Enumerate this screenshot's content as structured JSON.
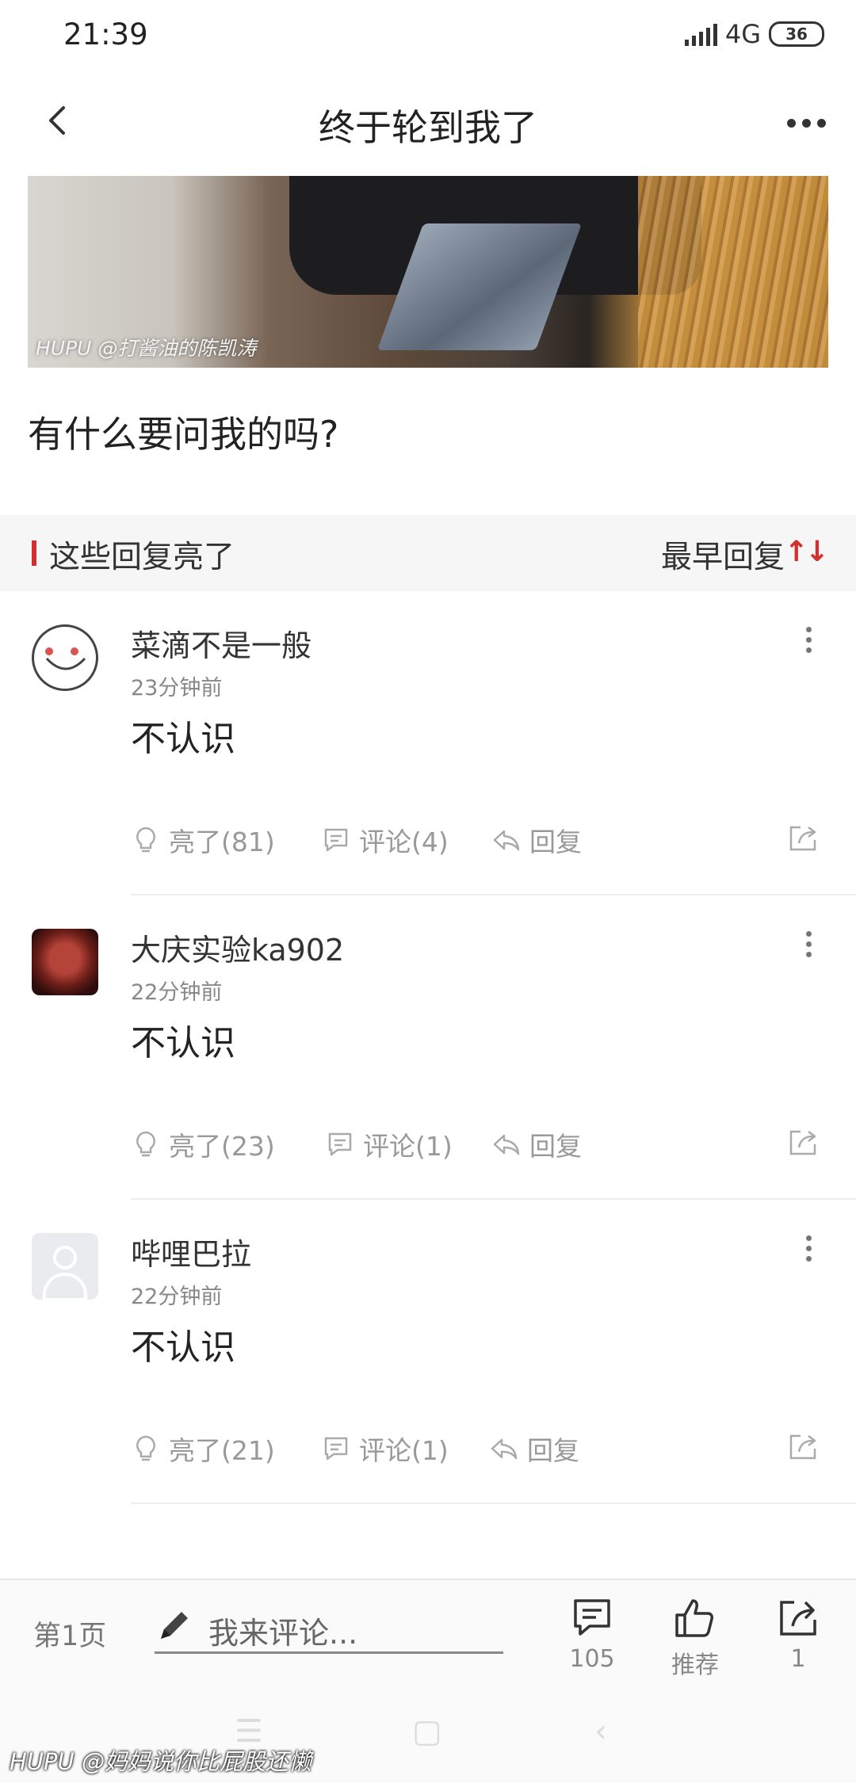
{
  "status_bar": {
    "time": "21:39",
    "network": "4G",
    "battery": "36"
  },
  "nav": {
    "title": "终于轮到我了"
  },
  "hero": {
    "watermark": "HUPU @打酱油的陈凯涛"
  },
  "post": {
    "text": "有什么要问我的吗?"
  },
  "highlights": {
    "title": "这些回复亮了",
    "sort_label": "最早回复",
    "sort_icon": "sort-arrows-icon"
  },
  "comments": [
    {
      "user": "菜滴不是一般",
      "time": "23分钟前",
      "text": "不认识",
      "light": "亮了(81)",
      "comment": "评论(4)",
      "reply": "回复"
    },
    {
      "user": "大庆实验ka902",
      "time": "22分钟前",
      "text": "不认识",
      "light": "亮了(23)",
      "comment": "评论(1)",
      "reply": "回复"
    },
    {
      "user": "哔哩巴拉",
      "time": "22分钟前",
      "text": "不认识",
      "light": "亮了(21)",
      "comment": "评论(1)",
      "reply": "回复"
    }
  ],
  "bottom_bar": {
    "page_label": "第1页",
    "input_placeholder": "我来评论...",
    "comment_count": "105",
    "recommend_label": "推荐",
    "share_count": "1"
  },
  "watermark_bottom": "HUPU @妈妈说你比屁股还懒",
  "colors": {
    "accent": "#d32f2f",
    "muted": "#999999"
  }
}
